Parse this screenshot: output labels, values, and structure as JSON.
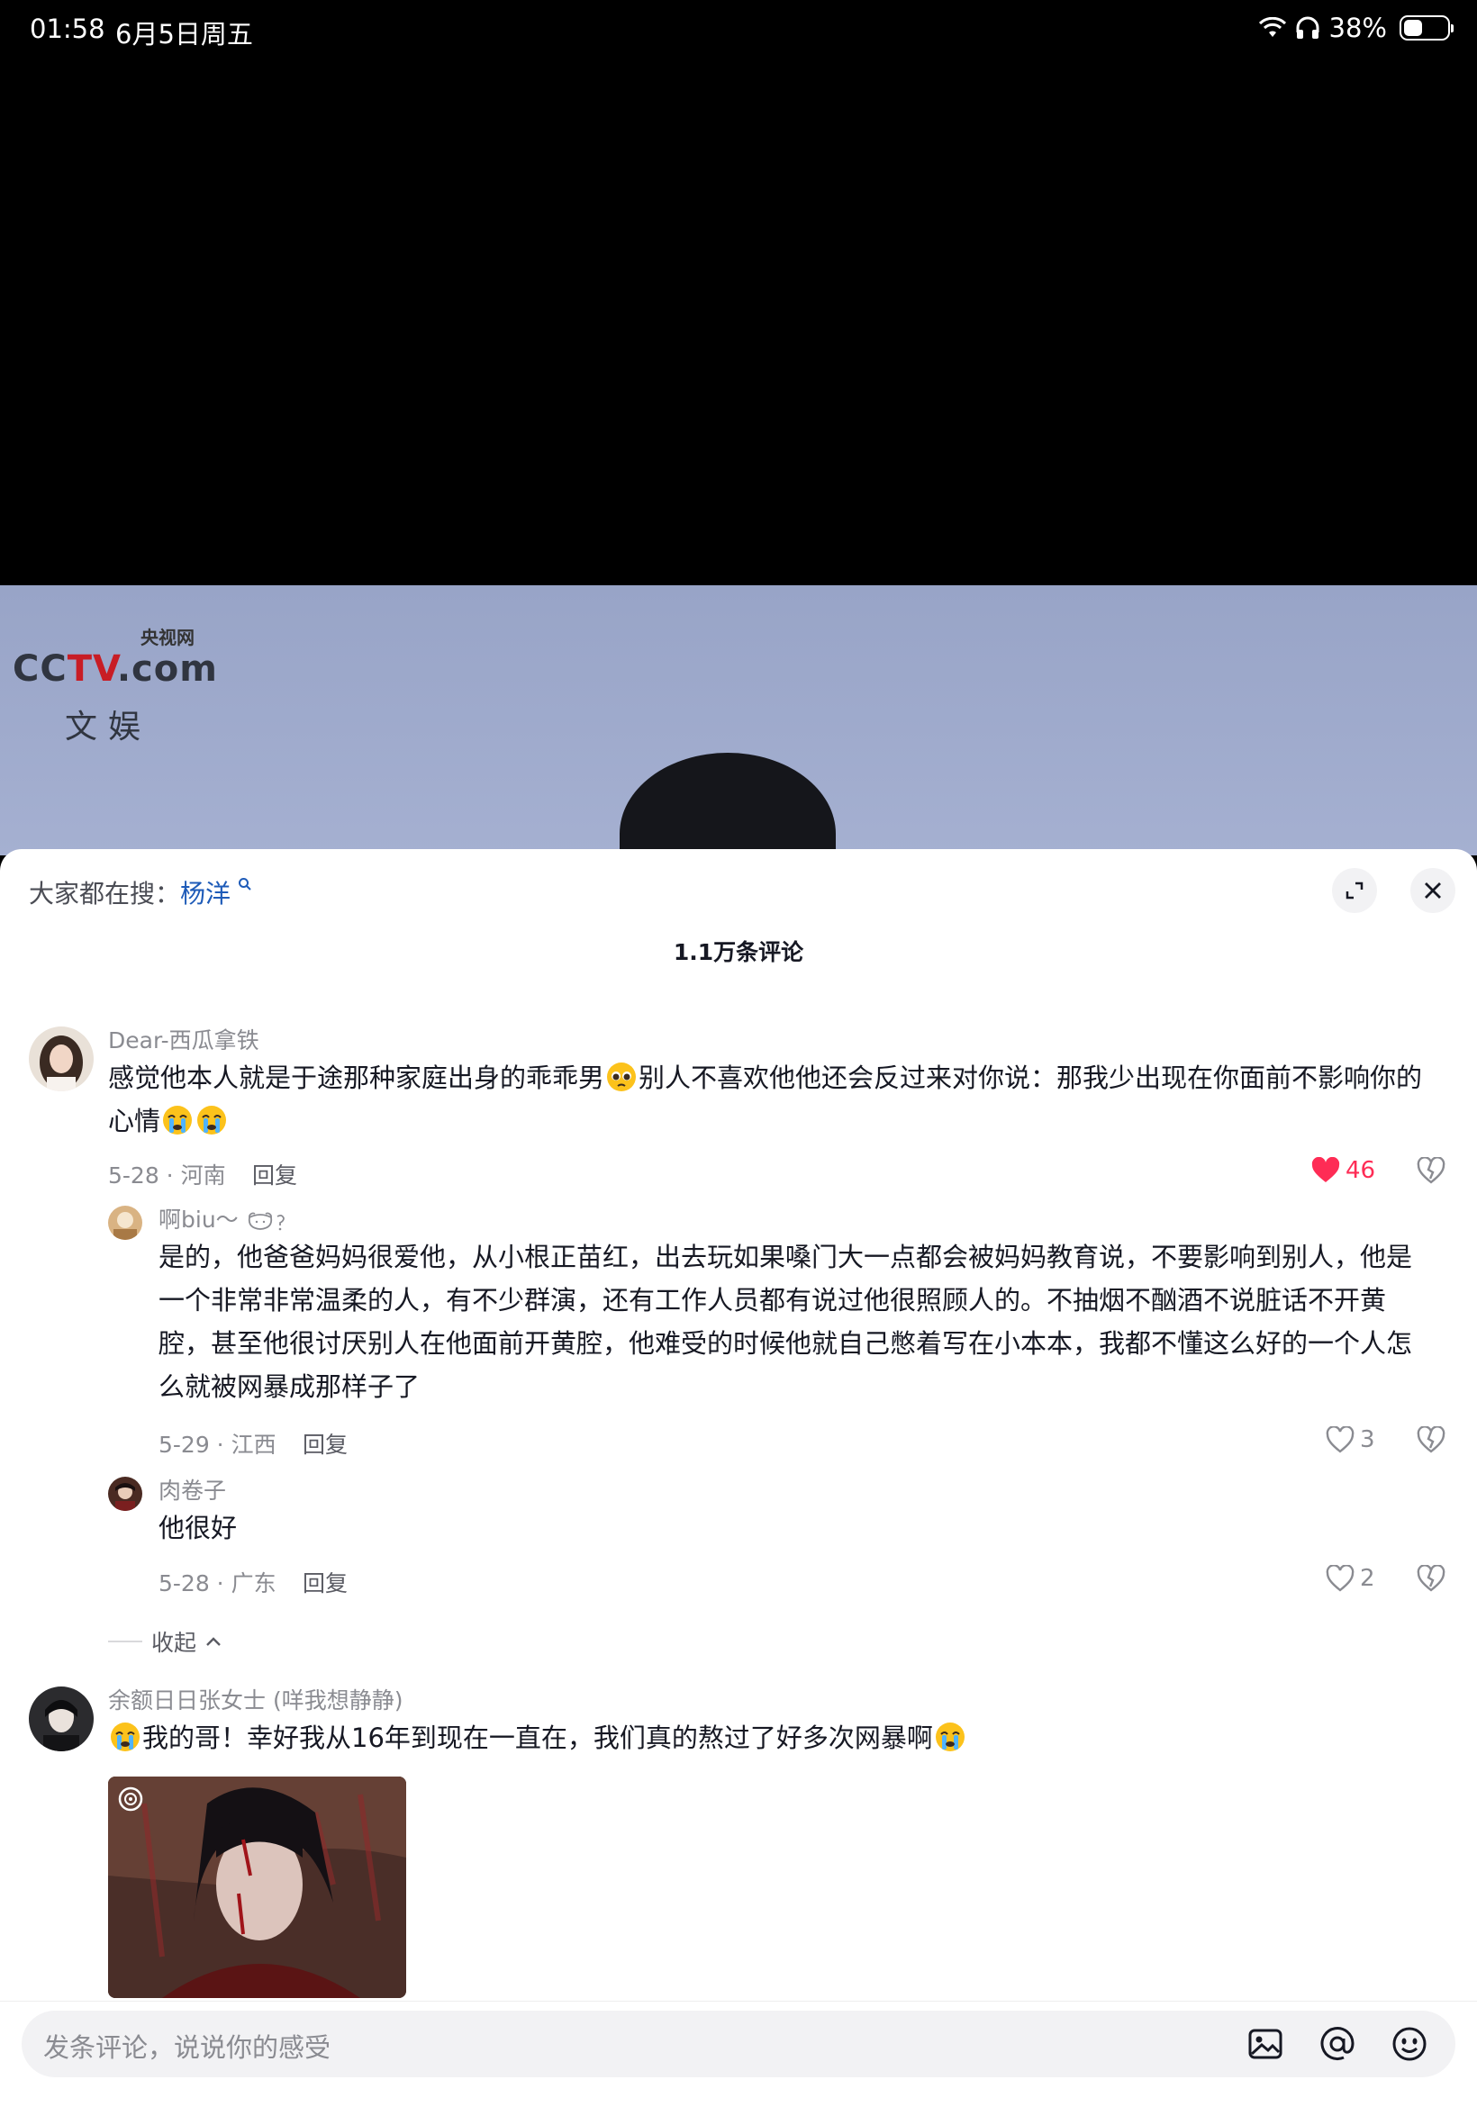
{
  "status_bar": {
    "time": "01:58",
    "date": "6月5日周五",
    "battery": "38%",
    "battery_level": 0.38
  },
  "video": {
    "logo_en_a": "CC",
    "logo_en_b": "TV",
    "logo_domain": ".com",
    "logo_cn": "央视网",
    "logo_sub": "文娱"
  },
  "sheet": {
    "search_prefix": "大家都在搜：",
    "search_keyword": "杨洋",
    "comment_count": "1.1万条评论"
  },
  "comments": [
    {
      "user": "Dear-西瓜拿铁",
      "text_a": "感觉他本人就是于途那种家庭出身的乖乖男",
      "text_b": "别人不喜欢他他还会反过来对你说：那我少出现在你面前不影响你的",
      "text_c": "心情",
      "meta": "5-28 · 河南",
      "reply": "回复",
      "likes": "46",
      "replies": [
        {
          "user": "啊biu～ ",
          "text": "是的，他爸爸妈妈很爱他，从小根正苗红，出去玩如果嗓门大一点都会被妈妈教育说，不要影响到别人，他是一个非常非常温柔的人，有不少群演，还有工作人员都有说过他很照顾人的。不抽烟不酗酒不说脏话不开黄腔，甚至他很讨厌别人在他面前开黄腔，他难受的时候他就自己憋着写在小本本，我都不懂这么好的一个人怎么就被网暴成那样子了",
          "meta": "5-29 · 江西",
          "reply": "回复",
          "likes": "3"
        },
        {
          "user": "肉卷子",
          "text": "他很好",
          "meta": "5-28 · 广东",
          "reply": "回复",
          "likes": "2"
        }
      ],
      "collapse": "收起"
    },
    {
      "user": "余额日日张女士 (咩我想静静)",
      "text_a": "我的哥！幸好我从16年到现在一直在，我们真的熬过了好多次网暴啊"
    }
  ],
  "input": {
    "placeholder": "发条评论，说说你的感受"
  }
}
